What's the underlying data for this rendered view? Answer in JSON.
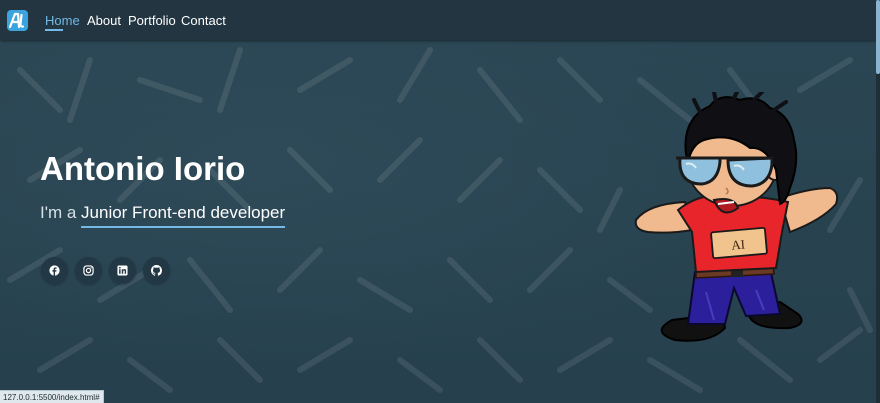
{
  "nav": {
    "logo_text": "AI",
    "links": [
      {
        "label": "Home",
        "active": true
      },
      {
        "label": "About",
        "active": false
      },
      {
        "label": "Portfolio",
        "active": false
      },
      {
        "label": "Contact",
        "active": false
      }
    ]
  },
  "hero": {
    "name": "Antonio Iorio",
    "tagline_prefix": "I'm a ",
    "role": "Junior Front-end developer"
  },
  "social": [
    {
      "name": "facebook",
      "icon": "facebook-icon"
    },
    {
      "name": "instagram",
      "icon": "instagram-icon"
    },
    {
      "name": "linkedin",
      "icon": "linkedin-icon"
    },
    {
      "name": "github",
      "icon": "github-icon"
    }
  ],
  "illustration": {
    "badge_text": "AI"
  },
  "status_bar": {
    "url": "127.0.0.1:5500/index.html#"
  },
  "colors": {
    "background": "#2a4350",
    "navbar": "#223541",
    "accent": "#74b8e6",
    "logo": "#3ba3dd",
    "text": "#ffffff"
  }
}
